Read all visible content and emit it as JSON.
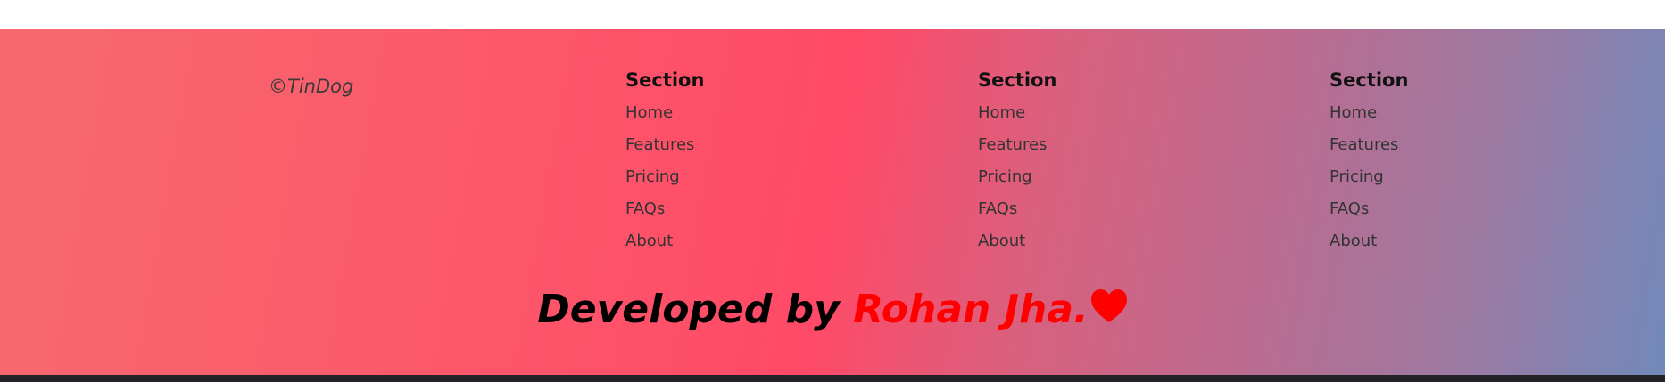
{
  "footer": {
    "copyright": "©TinDog",
    "columns": [
      {
        "title": "Section",
        "links": [
          "Home",
          "Features",
          "Pricing",
          "FAQs",
          "About"
        ]
      },
      {
        "title": "Section",
        "links": [
          "Home",
          "Features",
          "Pricing",
          "FAQs",
          "About"
        ]
      },
      {
        "title": "Section",
        "links": [
          "Home",
          "Features",
          "Pricing",
          "FAQs",
          "About"
        ]
      }
    ],
    "credit": {
      "prefix": "Developed by ",
      "name": "Rohan Jha.",
      "icon": "heart-icon",
      "name_color": "#ff0000",
      "icon_color": "#ff0000"
    }
  },
  "colors": {
    "gradient": [
      "#f7696f",
      "#ff4a67",
      "#7189bb"
    ],
    "bottom_bar": "#222326"
  }
}
